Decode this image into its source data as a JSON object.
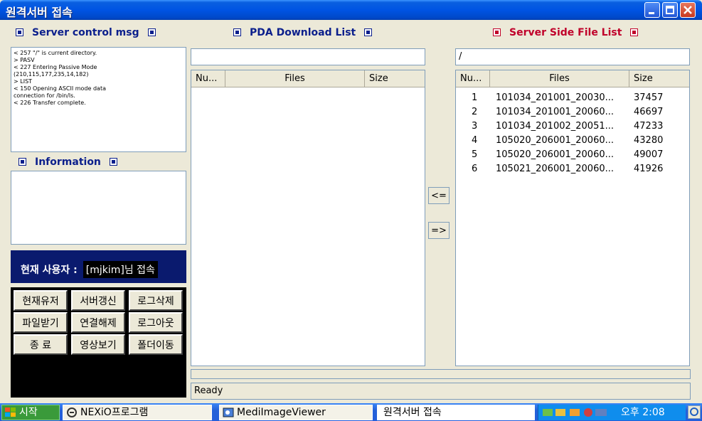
{
  "window": {
    "title": "원격서버 접속"
  },
  "panels": {
    "server_msg_title": "Server control msg",
    "pda_title": "PDA Download List",
    "server_files_title": "Server Side File List",
    "information_title": "Information"
  },
  "server_messages": [
    "< 257 \"/\" is current directory.",
    "> PASV",
    "< 227 Entering Passive Mode",
    "(210,115,177,235,14,182)",
    "> LIST",
    "< 150 Opening ASCII mode data",
    "connection for /bin/ls.",
    "< 226 Transfer complete."
  ],
  "user": {
    "label": "현재 사용자 :",
    "value": "[mjkim]님 접속"
  },
  "buttons": [
    [
      "현재유저",
      "서버갱신",
      "로그삭제"
    ],
    [
      "파일받기",
      "연결해제",
      "로그아웃"
    ],
    [
      "종  료",
      "영상보기",
      "폴더이동"
    ]
  ],
  "pda": {
    "path": "",
    "columns": [
      "Nu...",
      "Files",
      "Size"
    ],
    "rows": []
  },
  "server": {
    "path": "/",
    "columns": [
      "Nu...",
      "Files",
      "Size"
    ],
    "rows": [
      [
        "1",
        "101034_201001_20030...",
        "37457"
      ],
      [
        "2",
        "101034_201001_20060...",
        "46697"
      ],
      [
        "3",
        "101034_201002_20051...",
        "47233"
      ],
      [
        "4",
        "105020_206001_20060...",
        "43280"
      ],
      [
        "5",
        "105020_206001_20060...",
        "49007"
      ],
      [
        "6",
        "105021_206001_20060...",
        "41926"
      ]
    ]
  },
  "transfer": {
    "download_label": "<=",
    "upload_label": "=>"
  },
  "status": {
    "text": "Ready",
    "top_text": ""
  },
  "taskbar": {
    "start": "시작",
    "items": [
      "NEXiO프로그램",
      "MediImageViewer",
      "원격서버 접속"
    ],
    "clock": "오후 2:08"
  },
  "colors": {
    "titlebar": "#0054e3",
    "user_bar": "#0a1a6e",
    "header_blue": "#0b1f8c",
    "header_red": "#c0002a"
  }
}
